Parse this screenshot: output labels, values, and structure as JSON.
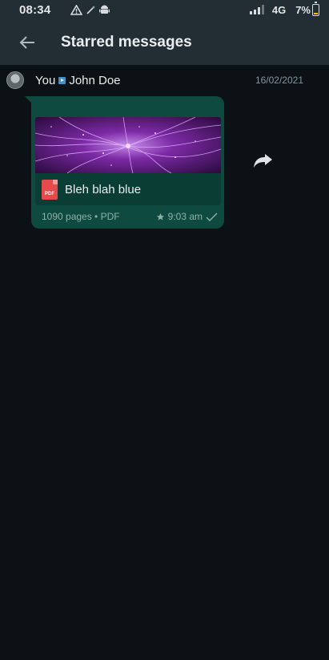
{
  "status_bar": {
    "time": "08:34",
    "network": "4G",
    "battery": "7%",
    "icons": [
      "warning-icon",
      "wand-icon",
      "android-icon"
    ]
  },
  "app_bar": {
    "back_icon": "arrow-left-icon",
    "title": "Starred messages"
  },
  "message": {
    "sender": "You",
    "recipient": "John Doe",
    "date": "16/02/2021",
    "document": {
      "name": "Bleh blah blue",
      "icon_label": "PDF",
      "meta": "1090 pages • PDF"
    },
    "time": "9:03 am",
    "starred": true,
    "status": "sent-check-icon"
  },
  "colors": {
    "background": "#0b1114",
    "app_bar": "#222d34",
    "bubble": "#0f4a40",
    "pdf_red": "#e64b4b"
  }
}
